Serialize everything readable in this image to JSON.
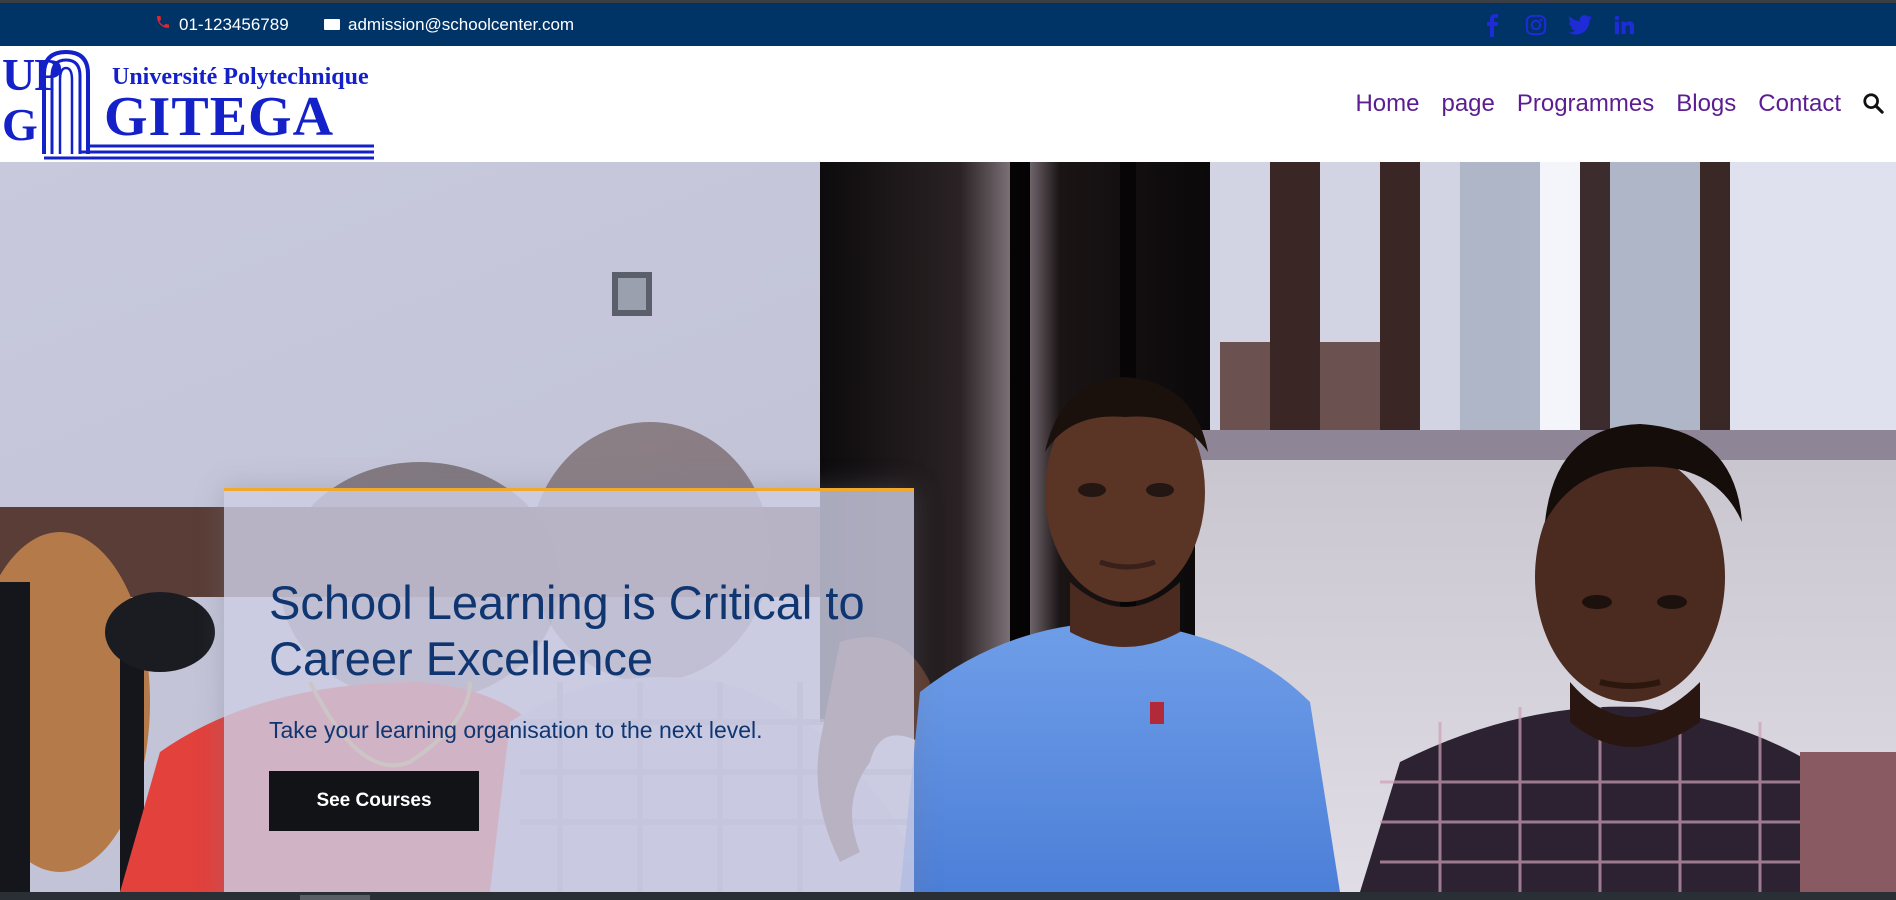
{
  "topbar": {
    "phone": "01-123456789",
    "email": "admission@schoolcenter.com",
    "social_icons": [
      "facebook-icon",
      "instagram-icon",
      "twitter-icon",
      "linkedin-icon"
    ]
  },
  "logo": {
    "monogram_top": "UP",
    "monogram_bottom": "G",
    "line1": "Université Polytechnique",
    "line2": "GITEGA"
  },
  "nav": {
    "items": [
      "Home",
      "page",
      "Programmes",
      "Blogs",
      "Contact"
    ],
    "search_icon": "search-icon"
  },
  "hero": {
    "title": "School Learning is Critical to Career Excellence",
    "subtitle": "Take your learning organisation to the next level.",
    "cta": "See Courses"
  },
  "colors": {
    "topbar_bg": "#003366",
    "nav_link": "#5b1d91",
    "social_icon": "#1e2bd6",
    "hero_title": "#0f3670",
    "card_border": "#f0a92a",
    "button_bg": "#121316"
  }
}
